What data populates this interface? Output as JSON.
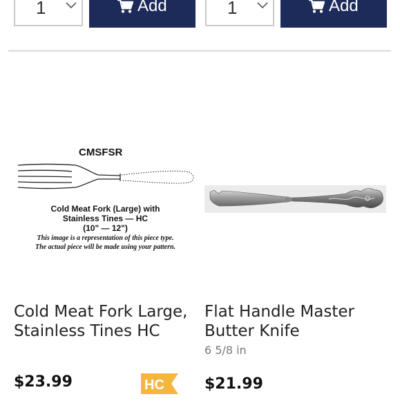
{
  "toolbar": [
    {
      "quantity": "1",
      "add_label": "Add"
    },
    {
      "quantity": "1",
      "add_label": "Add"
    }
  ],
  "products": [
    {
      "title_line1": "Cold Meat Fork Large,",
      "title_line2": "Stainless Tines HC",
      "subtitle": "",
      "price": "$23.99",
      "badge": "HC",
      "badge_color": "#f4b63f",
      "diagram": {
        "code": "CMSFSR",
        "line1": "Cold Meat Fork (Large) with",
        "line2": "Stainless Tines — HC",
        "line3": "(10\" — 12\")",
        "note1": "This image is a representation of this piece type.",
        "note2": "The actual piece will be made using your pattern."
      }
    },
    {
      "title_line1": "Flat Handle Master",
      "title_line2": "Butter Knife",
      "subtitle": "6 5/8 in",
      "price": "$21.99"
    }
  ],
  "colors": {
    "button_bg": "#1d2b5a",
    "divider": "#e3e3e3"
  },
  "icons": [
    "cart-icon",
    "chevron-down-icon",
    "hc-badge-icon"
  ]
}
